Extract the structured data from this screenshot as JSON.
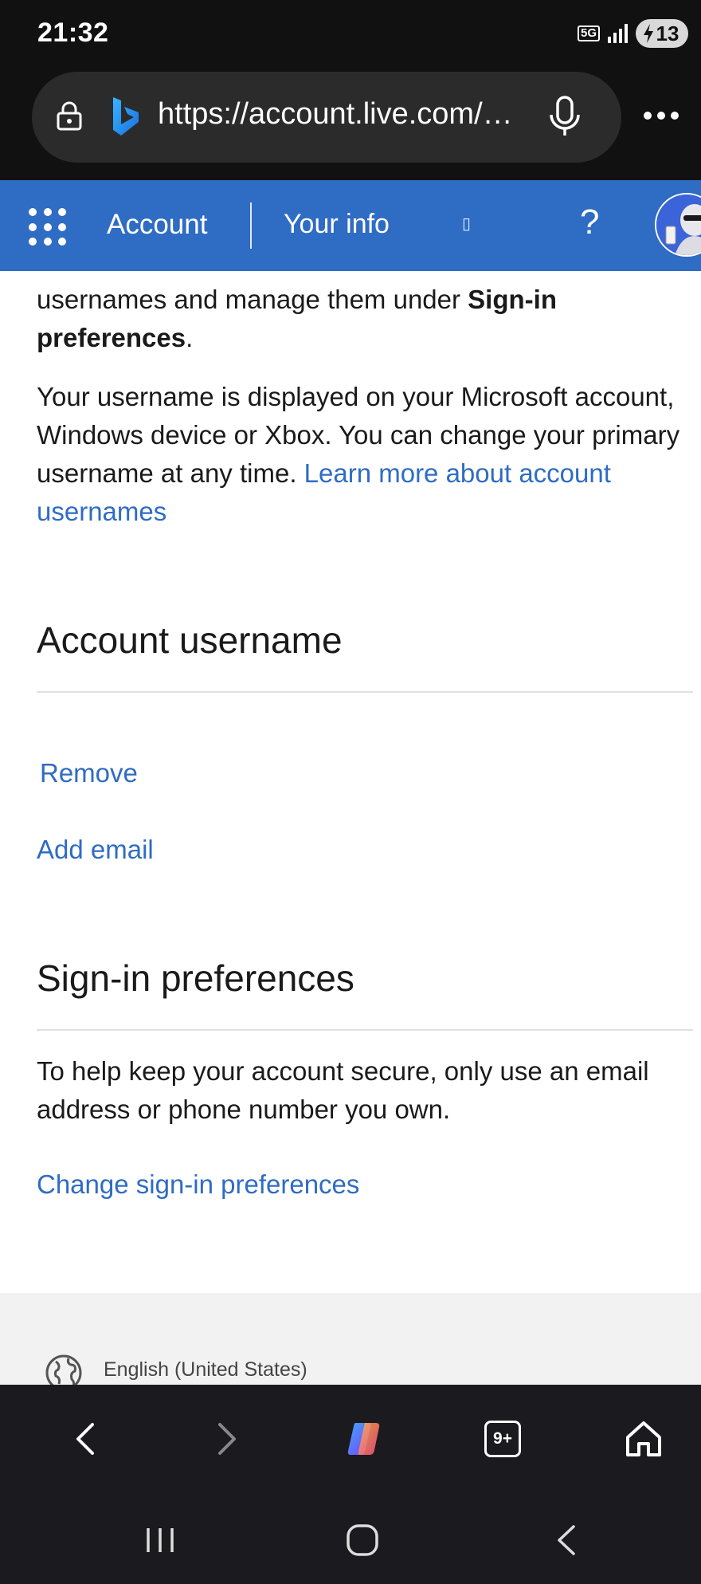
{
  "status_bar": {
    "time": "21:32",
    "network": "5G",
    "battery": "13"
  },
  "browser": {
    "url": "https://account.live.com/…",
    "icons": [
      "lock-icon",
      "bing-icon",
      "mic-icon",
      "more-icon"
    ]
  },
  "header": {
    "account": "Account",
    "your_info": "Your info",
    "missing_glyph": "▯",
    "help": "?"
  },
  "content": {
    "intro_prefix": "usernames and manage them under ",
    "intro_bold": "Sign-in preferences",
    "intro_suffix": ".",
    "username_text": "Your username is displayed on your Microsoft account, Windows device or Xbox. You can change your primary username at any time. ",
    "learn_more_link": "Learn more about account usernames",
    "account_username_heading": "Account username",
    "remove_link": "Remove",
    "add_email_link": "Add email",
    "signin_heading": "Sign-in preferences",
    "signin_text": "To help keep your account secure, only use an email address or phone number you own.",
    "change_signin_link": "Change sign-in preferences"
  },
  "footer": {
    "language": "English (United States)"
  },
  "toolbar": {
    "tabs_count": "9+"
  },
  "colors": {
    "accent": "#2f6cc4",
    "header_bg": "#2f6cc4",
    "chrome_bg": "#111111"
  }
}
